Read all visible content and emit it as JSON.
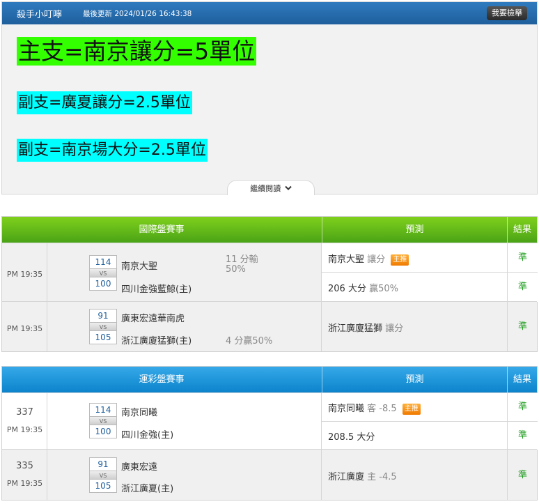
{
  "header": {
    "author": "殺手小叮嚀",
    "updated": "最後更新 2024/01/26 16:43:38",
    "action_label": "我要檢舉"
  },
  "picks": {
    "main": "主支=南京讓分=5單位",
    "sub1": "副支=廣夏讓分=2.5單位",
    "sub2": "副支=南京場大分=2.5單位"
  },
  "read_more": "繼續閱讀",
  "colors": {
    "main_highlight": "#33ff00",
    "sub_highlight": "#00ffff",
    "result_green": "#1a9a1a",
    "badge_orange": "#f07a00"
  },
  "international": {
    "title": "國際盤賽事",
    "pred_header": "預測",
    "result_header": "結果",
    "matches": [
      {
        "time": "PM 19:35",
        "score_home": "114",
        "vs": "VS",
        "score_away": "100",
        "team1": "南京大聖",
        "team2": "四川金強藍鯨(主)",
        "note1": "11 分輸",
        "note2": "50%",
        "preds": [
          {
            "team": "南京大聖",
            "type": "讓分",
            "badge": "主推",
            "result": "準"
          },
          {
            "team": "206 大分",
            "type": "贏50%",
            "result": "準"
          }
        ]
      },
      {
        "time": "PM 19:35",
        "score_home": "91",
        "vs": "VS",
        "score_away": "105",
        "team1": "廣東宏遠華南虎",
        "team2": "浙江廣廈猛獅(主)",
        "note": "4 分贏50%",
        "preds": [
          {
            "team": "浙江廣廈猛獅",
            "type": "讓分",
            "result": "準"
          }
        ]
      }
    ]
  },
  "lottery": {
    "title": "運彩盤賽事",
    "pred_header": "預測",
    "result_header": "結果",
    "matches": [
      {
        "num": "337",
        "time": "PM 19:35",
        "score_home": "114",
        "vs": "VS",
        "score_away": "100",
        "team1": "南京同曦",
        "team2": "四川金強(主)",
        "preds": [
          {
            "team": "南京同曦",
            "type": "客 -8.5",
            "badge": "主推",
            "result": "準"
          },
          {
            "team": "208.5 大分",
            "result": "準"
          }
        ]
      },
      {
        "num": "335",
        "time": "PM 19:35",
        "score_home": "91",
        "vs": "VS",
        "score_away": "105",
        "team1": "廣東宏遠",
        "team2": "浙江廣夏(主)",
        "preds": [
          {
            "team": "浙江廣廈",
            "type": "主 -4.5",
            "result": "準"
          }
        ]
      }
    ]
  }
}
